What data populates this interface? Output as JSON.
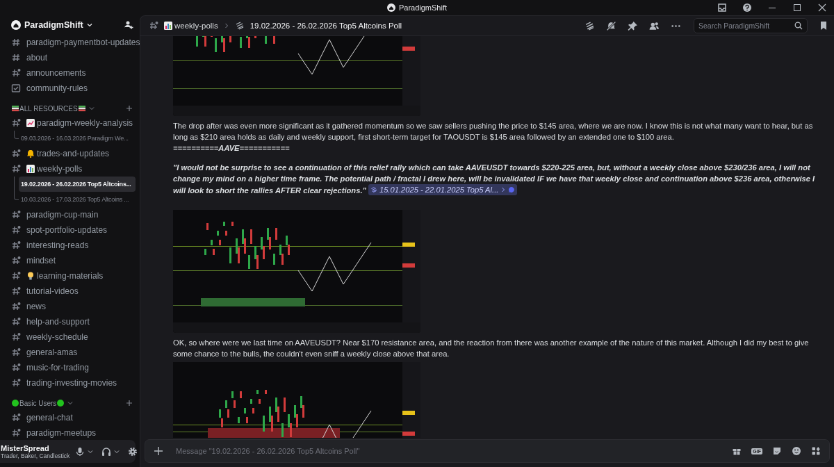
{
  "titlebar": {
    "title": "ParadigmShift"
  },
  "server": {
    "name": "ParadigmShift"
  },
  "sidebar": {
    "sections": [
      {
        "items": [
          {
            "name": "paradigm-paymentbot-updates",
            "kind": "text"
          },
          {
            "name": "about",
            "kind": "text"
          },
          {
            "name": "announcements",
            "kind": "news"
          },
          {
            "name": "community-rules",
            "kind": "rules"
          }
        ]
      },
      {
        "category": "ALL RESOURCES",
        "items": [
          {
            "name": "paradigm-weekly-analysis",
            "kind": "news",
            "threads": [
              {
                "title": "09.03.2026 - 16.03.2026 Paradigm We...",
                "selected": false
              }
            ]
          },
          {
            "name": "trades-and-updates",
            "kind": "news"
          },
          {
            "name": "weekly-polls",
            "kind": "news",
            "threads": [
              {
                "title": "19.02.2026 - 26.02.2026 Top5 Altcoins...",
                "selected": true
              },
              {
                "title": "10.03.2026 - 17.03.2026 Top5 Altcoins ...",
                "selected": false
              }
            ]
          },
          {
            "name": "paradigm-cup-main",
            "kind": "news"
          },
          {
            "name": "spot-portfolio-updates",
            "kind": "news"
          },
          {
            "name": "interesting-reads",
            "kind": "news"
          },
          {
            "name": "mindset",
            "kind": "news"
          },
          {
            "name": "learning-materials",
            "kind": "news"
          },
          {
            "name": "tutorial-videos",
            "kind": "news"
          },
          {
            "name": "news",
            "kind": "news"
          },
          {
            "name": "help-and-support",
            "kind": "news"
          },
          {
            "name": "weekly-schedule",
            "kind": "news"
          },
          {
            "name": "general-amas",
            "kind": "news"
          },
          {
            "name": "music-for-trading",
            "kind": "news"
          },
          {
            "name": "trading-investing-movies",
            "kind": "news"
          }
        ]
      },
      {
        "category": "Basic Users",
        "items": [
          {
            "name": "general-chat",
            "kind": "news"
          },
          {
            "name": "paradigm-meetups",
            "kind": "news"
          }
        ]
      }
    ]
  },
  "user": {
    "name": "MisterSpread",
    "status": "Trader, Baker, Candlestick"
  },
  "header": {
    "channel": "weekly-polls",
    "thread": "19.02.2026 - 26.02.2026 Top5 Altcoins Poll",
    "search": {
      "placeholder": "Search ParadigmShift"
    }
  },
  "messages": [
    {
      "kind": "picture"
    },
    {
      "kind": "text",
      "text": "The drop after was even more significant as it gathered momentum so we saw sellers pushing the price to $145 area, where we are now. I know this is not what many want to hear, but as long as $210 area holds as daily and weekly support, first short-term target for TAOUSDT is $145 area followed by an extended one to $100 area."
    },
    {
      "kind": "heading",
      "text": "==========AAVE==========="
    },
    {
      "kind": "quote",
      "text": "\"I would not be surprise to see a continuation of this relief rally which can take AAVEUSDT towards $220-225 area, but, without a weekly close above $230/236 area, I will not change my mind on a higher time frame. The potential path / fractal I drew here, will be invalidated IF we have that weekly close and continuation above $236 area, otherwise I will look to short the rallies AFTER clear rejections.\"",
      "link": "15.01.2025 - 22.01.2025 Top5 Al..."
    },
    {
      "kind": "picture"
    },
    {
      "kind": "text",
      "text": "OK, so where were we last time on AAVEUSDT? Near $170 resistance area, and the reaction from there was another example of the nature of this market. Although I did my best to give some chance to the bulls, the couldn't even sniff a weekly close above that area."
    },
    {
      "kind": "picture"
    }
  ],
  "composer": {
    "placeholder": "Message \"19.02.2026 - 26.02.2026 Top5 Altcoins Poll\"",
    "buttons": [
      {
        "kind": "gift"
      },
      {
        "kind": "gif",
        "label": "GIF"
      },
      {
        "kind": "sticker"
      },
      {
        "kind": "emoji"
      },
      {
        "kind": "apps"
      }
    ]
  }
}
